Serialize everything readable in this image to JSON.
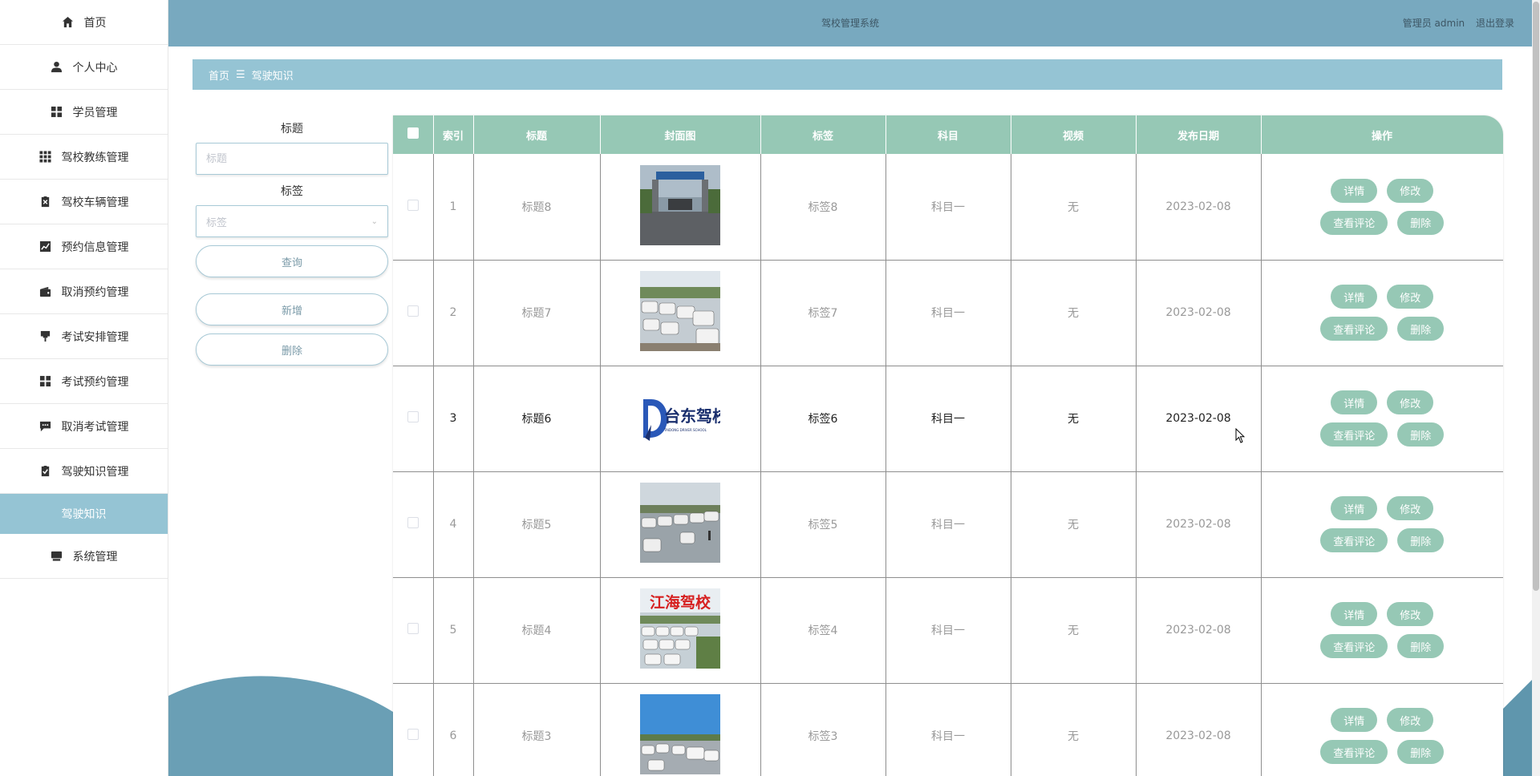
{
  "app": {
    "title": "驾校管理系统"
  },
  "topbar": {
    "user_label": "管理员 admin",
    "logout_label": "退出登录"
  },
  "sidebar": {
    "items": [
      {
        "label": "首页",
        "icon": "home-icon"
      },
      {
        "label": "个人中心",
        "icon": "user-icon"
      },
      {
        "label": "学员管理",
        "icon": "grid-icon"
      },
      {
        "label": "驾校教练管理",
        "icon": "apps-icon"
      },
      {
        "label": "驾校车辆管理",
        "icon": "clipboard-icon"
      },
      {
        "label": "预约信息管理",
        "icon": "chart-icon"
      },
      {
        "label": "取消预约管理",
        "icon": "wallet-icon"
      },
      {
        "label": "考试安排管理",
        "icon": "pin-icon"
      },
      {
        "label": "考试预约管理",
        "icon": "grid-icon"
      },
      {
        "label": "取消考试管理",
        "icon": "message-icon"
      },
      {
        "label": "驾驶知识管理",
        "icon": "clipboard-check-icon"
      },
      {
        "label": "驾驶知识",
        "active": true
      },
      {
        "label": "系统管理",
        "icon": "monitor-icon"
      }
    ]
  },
  "breadcrumb": {
    "home": "首页",
    "separator": "☰",
    "current": "驾驶知识"
  },
  "filter": {
    "title_label": "标题",
    "title_placeholder": "标题",
    "tag_label": "标签",
    "tag_placeholder": "标签",
    "query_button": "查询",
    "add_button": "新增",
    "delete_button": "删除"
  },
  "table": {
    "headers": [
      "索引",
      "标题",
      "封面图",
      "标签",
      "科目",
      "视频",
      "发布日期",
      "操作"
    ],
    "actions": {
      "detail": "详情",
      "edit": "修改",
      "comments": "查看评论",
      "delete": "删除"
    },
    "rows": [
      {
        "index": "1",
        "title": "标题8",
        "tag": "标签8",
        "subject": "科目一",
        "video": "无",
        "date": "2023-02-08",
        "cover": "gate"
      },
      {
        "index": "2",
        "title": "标题7",
        "tag": "标签7",
        "subject": "科目一",
        "video": "无",
        "date": "2023-02-08",
        "cover": "cars"
      },
      {
        "index": "3",
        "title": "标题6",
        "tag": "标签6",
        "subject": "科目一",
        "video": "无",
        "date": "2023-02-08",
        "cover": "logo"
      },
      {
        "index": "4",
        "title": "标题5",
        "tag": "标签5",
        "subject": "科目一",
        "video": "无",
        "date": "2023-02-08",
        "cover": "yard"
      },
      {
        "index": "5",
        "title": "标题4",
        "tag": "标签4",
        "subject": "科目一",
        "video": "无",
        "date": "2023-02-08",
        "cover": "jianghai"
      },
      {
        "index": "6",
        "title": "标题3",
        "tag": "标签3",
        "subject": "科目一",
        "video": "无",
        "date": "2023-02-08",
        "cover": "sky"
      }
    ]
  },
  "cover_logo_text": "台东驾校",
  "cover_logo_sub": "TAIDONG DRIVER SCHOOL",
  "cover_jianghai_text": "江海驾校",
  "colors": {
    "topbar": "#78a9bf",
    "accent": "#96c8b5",
    "breadcrumb": "#95c4d4"
  }
}
